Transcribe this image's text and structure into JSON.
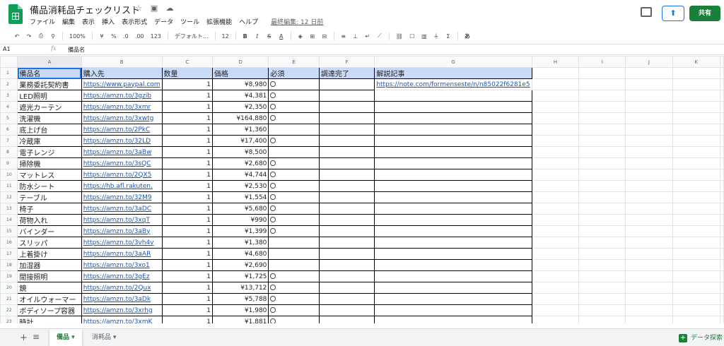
{
  "app": {
    "title": "備品消耗品チェックリスト",
    "star_icon": "☆",
    "move_icon": "▣",
    "cloud_icon": "☁",
    "menu": [
      "ファイル",
      "編集",
      "表示",
      "挿入",
      "表示形式",
      "データ",
      "ツール",
      "拡張機能",
      "ヘルプ"
    ],
    "last_edit": "最終編集: 12 日前",
    "share_label": "共有",
    "present_icon": "⬆"
  },
  "toolbar": {
    "undo": "↶",
    "redo": "↷",
    "print": "⎙",
    "paint_format": "⚲",
    "zoom": "100%",
    "currency": "¥",
    "percent": "%",
    "decimal_less": ".0",
    "decimal_more": ".00",
    "number_format": "123",
    "font": "デフォルト...",
    "font_size": "12",
    "bold": "B",
    "italic": "I",
    "strikethrough": "S",
    "text_color": "A",
    "fill_color": "◈",
    "borders": "⊞",
    "merge": "⊟",
    "halign": "≡",
    "valign": "⊥",
    "wrap": "↵",
    "rotate": "⟋",
    "link": "⛓",
    "comment": "☐",
    "chart": "▥",
    "filter": "⏚",
    "functions": "Σ",
    "input_tools": "あ"
  },
  "formula_bar": {
    "cell_ref": "A1",
    "fx": "fx",
    "content": "備品名"
  },
  "grid": {
    "columns": [
      "A",
      "B",
      "C",
      "D",
      "E",
      "F",
      "G",
      "H",
      "I",
      "J",
      "K"
    ],
    "header": [
      "備品名",
      "購入先",
      "数量",
      "価格",
      "必須",
      "調達完了",
      "解説記事"
    ],
    "rows": [
      {
        "n": "2",
        "name": "業務委託契約書",
        "url": "https://www.paypal.com",
        "qty": "1",
        "price": "¥8,980",
        "req": true,
        "article": "https://note.com/formenseste/n/n85022f6281e5"
      },
      {
        "n": "3",
        "name": "LED照明",
        "url": "https://amzn.to/3gzib",
        "qty": "1",
        "price": "¥4,381",
        "req": true,
        "article": ""
      },
      {
        "n": "4",
        "name": "遮光カーテン",
        "url": "https://amzn.to/3xmr",
        "qty": "1",
        "price": "¥2,350",
        "req": true,
        "article": ""
      },
      {
        "n": "5",
        "name": "洗濯機",
        "url": "https://amzn.to/3xwtg",
        "qty": "1",
        "price": "¥164,880",
        "req": true,
        "article": ""
      },
      {
        "n": "6",
        "name": "底上げ台",
        "url": "https://amzn.to/2PkC",
        "qty": "1",
        "price": "¥1,360",
        "req": false,
        "article": ""
      },
      {
        "n": "7",
        "name": "冷蔵庫",
        "url": "https://amzn.to/32LD",
        "qty": "1",
        "price": "¥17,400",
        "req": true,
        "article": ""
      },
      {
        "n": "8",
        "name": "電子レンジ",
        "url": "https://amzn.to/3aBw",
        "qty": "1",
        "price": "¥8,500",
        "req": false,
        "article": ""
      },
      {
        "n": "9",
        "name": "掃除機",
        "url": "https://amzn.to/3sQC",
        "qty": "1",
        "price": "¥2,680",
        "req": true,
        "article": ""
      },
      {
        "n": "10",
        "name": "マットレス",
        "url": "https://amzn.to/2QX5",
        "qty": "1",
        "price": "¥4,744",
        "req": true,
        "article": ""
      },
      {
        "n": "11",
        "name": "防水シート",
        "url": "https://hb.afl.rakuten.",
        "qty": "1",
        "price": "¥2,530",
        "req": true,
        "article": ""
      },
      {
        "n": "12",
        "name": "テーブル",
        "url": "https://amzn.to/32M9",
        "qty": "1",
        "price": "¥1,554",
        "req": true,
        "article": ""
      },
      {
        "n": "13",
        "name": "椅子",
        "url": "https://amzn.to/3aDC",
        "qty": "1",
        "price": "¥5,680",
        "req": true,
        "article": ""
      },
      {
        "n": "14",
        "name": "荷物入れ",
        "url": "https://amzn.to/3xqT",
        "qty": "1",
        "price": "¥990",
        "req": true,
        "article": ""
      },
      {
        "n": "15",
        "name": "バインダー",
        "url": "https://amzn.to/3aBy",
        "qty": "1",
        "price": "¥1,399",
        "req": true,
        "article": ""
      },
      {
        "n": "16",
        "name": "スリッパ",
        "url": "https://amzn.to/3vh4v",
        "qty": "1",
        "price": "¥1,380",
        "req": false,
        "article": ""
      },
      {
        "n": "17",
        "name": "上着掛け",
        "url": "https://amzn.to/3aAR",
        "qty": "1",
        "price": "¥4,680",
        "req": false,
        "article": ""
      },
      {
        "n": "18",
        "name": "加湿器",
        "url": "https://amzn.to/3xo1",
        "qty": "1",
        "price": "¥2,690",
        "req": false,
        "article": ""
      },
      {
        "n": "19",
        "name": "間接照明",
        "url": "https://amzn.to/3gEz",
        "qty": "1",
        "price": "¥1,725",
        "req": true,
        "article": ""
      },
      {
        "n": "20",
        "name": "鏡",
        "url": "https://amzn.to/2Qux",
        "qty": "1",
        "price": "¥13,712",
        "req": true,
        "article": ""
      },
      {
        "n": "21",
        "name": "オイルウォーマー",
        "url": "https://amzn.to/3aDk",
        "qty": "1",
        "price": "¥5,788",
        "req": true,
        "article": ""
      },
      {
        "n": "22",
        "name": "ボディソープ容器",
        "url": "https://amzn.to/3xrhg",
        "qty": "1",
        "price": "¥1,980",
        "req": true,
        "article": ""
      },
      {
        "n": "23",
        "name": "時計",
        "url": "https://amzn.to/3xmK",
        "qty": "1",
        "price": "¥1,881",
        "req": true,
        "article": ""
      }
    ]
  },
  "sheets": {
    "add": "+",
    "all": "≡",
    "tabs": [
      "備品",
      "消耗品"
    ],
    "explore_label": "データ探索"
  }
}
